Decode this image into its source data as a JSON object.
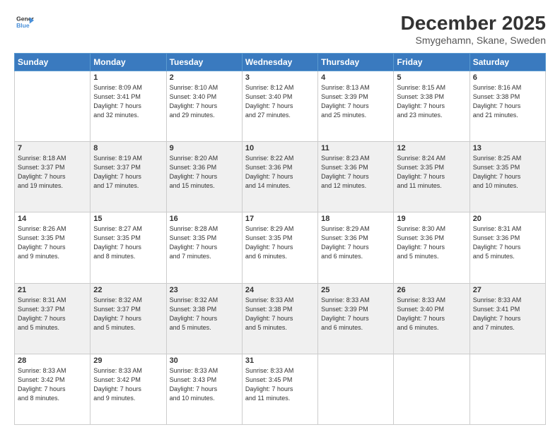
{
  "header": {
    "logo_line1": "General",
    "logo_line2": "Blue",
    "month": "December 2025",
    "location": "Smygehamn, Skane, Sweden"
  },
  "days_of_week": [
    "Sunday",
    "Monday",
    "Tuesday",
    "Wednesday",
    "Thursday",
    "Friday",
    "Saturday"
  ],
  "weeks": [
    {
      "shaded": false,
      "days": [
        {
          "date": "",
          "info": ""
        },
        {
          "date": "1",
          "info": "Sunrise: 8:09 AM\nSunset: 3:41 PM\nDaylight: 7 hours\nand 32 minutes."
        },
        {
          "date": "2",
          "info": "Sunrise: 8:10 AM\nSunset: 3:40 PM\nDaylight: 7 hours\nand 29 minutes."
        },
        {
          "date": "3",
          "info": "Sunrise: 8:12 AM\nSunset: 3:40 PM\nDaylight: 7 hours\nand 27 minutes."
        },
        {
          "date": "4",
          "info": "Sunrise: 8:13 AM\nSunset: 3:39 PM\nDaylight: 7 hours\nand 25 minutes."
        },
        {
          "date": "5",
          "info": "Sunrise: 8:15 AM\nSunset: 3:38 PM\nDaylight: 7 hours\nand 23 minutes."
        },
        {
          "date": "6",
          "info": "Sunrise: 8:16 AM\nSunset: 3:38 PM\nDaylight: 7 hours\nand 21 minutes."
        }
      ]
    },
    {
      "shaded": true,
      "days": [
        {
          "date": "7",
          "info": "Sunrise: 8:18 AM\nSunset: 3:37 PM\nDaylight: 7 hours\nand 19 minutes."
        },
        {
          "date": "8",
          "info": "Sunrise: 8:19 AM\nSunset: 3:37 PM\nDaylight: 7 hours\nand 17 minutes."
        },
        {
          "date": "9",
          "info": "Sunrise: 8:20 AM\nSunset: 3:36 PM\nDaylight: 7 hours\nand 15 minutes."
        },
        {
          "date": "10",
          "info": "Sunrise: 8:22 AM\nSunset: 3:36 PM\nDaylight: 7 hours\nand 14 minutes."
        },
        {
          "date": "11",
          "info": "Sunrise: 8:23 AM\nSunset: 3:36 PM\nDaylight: 7 hours\nand 12 minutes."
        },
        {
          "date": "12",
          "info": "Sunrise: 8:24 AM\nSunset: 3:35 PM\nDaylight: 7 hours\nand 11 minutes."
        },
        {
          "date": "13",
          "info": "Sunrise: 8:25 AM\nSunset: 3:35 PM\nDaylight: 7 hours\nand 10 minutes."
        }
      ]
    },
    {
      "shaded": false,
      "days": [
        {
          "date": "14",
          "info": "Sunrise: 8:26 AM\nSunset: 3:35 PM\nDaylight: 7 hours\nand 9 minutes."
        },
        {
          "date": "15",
          "info": "Sunrise: 8:27 AM\nSunset: 3:35 PM\nDaylight: 7 hours\nand 8 minutes."
        },
        {
          "date": "16",
          "info": "Sunrise: 8:28 AM\nSunset: 3:35 PM\nDaylight: 7 hours\nand 7 minutes."
        },
        {
          "date": "17",
          "info": "Sunrise: 8:29 AM\nSunset: 3:35 PM\nDaylight: 7 hours\nand 6 minutes."
        },
        {
          "date": "18",
          "info": "Sunrise: 8:29 AM\nSunset: 3:36 PM\nDaylight: 7 hours\nand 6 minutes."
        },
        {
          "date": "19",
          "info": "Sunrise: 8:30 AM\nSunset: 3:36 PM\nDaylight: 7 hours\nand 5 minutes."
        },
        {
          "date": "20",
          "info": "Sunrise: 8:31 AM\nSunset: 3:36 PM\nDaylight: 7 hours\nand 5 minutes."
        }
      ]
    },
    {
      "shaded": true,
      "days": [
        {
          "date": "21",
          "info": "Sunrise: 8:31 AM\nSunset: 3:37 PM\nDaylight: 7 hours\nand 5 minutes."
        },
        {
          "date": "22",
          "info": "Sunrise: 8:32 AM\nSunset: 3:37 PM\nDaylight: 7 hours\nand 5 minutes."
        },
        {
          "date": "23",
          "info": "Sunrise: 8:32 AM\nSunset: 3:38 PM\nDaylight: 7 hours\nand 5 minutes."
        },
        {
          "date": "24",
          "info": "Sunrise: 8:33 AM\nSunset: 3:38 PM\nDaylight: 7 hours\nand 5 minutes."
        },
        {
          "date": "25",
          "info": "Sunrise: 8:33 AM\nSunset: 3:39 PM\nDaylight: 7 hours\nand 6 minutes."
        },
        {
          "date": "26",
          "info": "Sunrise: 8:33 AM\nSunset: 3:40 PM\nDaylight: 7 hours\nand 6 minutes."
        },
        {
          "date": "27",
          "info": "Sunrise: 8:33 AM\nSunset: 3:41 PM\nDaylight: 7 hours\nand 7 minutes."
        }
      ]
    },
    {
      "shaded": false,
      "days": [
        {
          "date": "28",
          "info": "Sunrise: 8:33 AM\nSunset: 3:42 PM\nDaylight: 7 hours\nand 8 minutes."
        },
        {
          "date": "29",
          "info": "Sunrise: 8:33 AM\nSunset: 3:42 PM\nDaylight: 7 hours\nand 9 minutes."
        },
        {
          "date": "30",
          "info": "Sunrise: 8:33 AM\nSunset: 3:43 PM\nDaylight: 7 hours\nand 10 minutes."
        },
        {
          "date": "31",
          "info": "Sunrise: 8:33 AM\nSunset: 3:45 PM\nDaylight: 7 hours\nand 11 minutes."
        },
        {
          "date": "",
          "info": ""
        },
        {
          "date": "",
          "info": ""
        },
        {
          "date": "",
          "info": ""
        }
      ]
    }
  ]
}
